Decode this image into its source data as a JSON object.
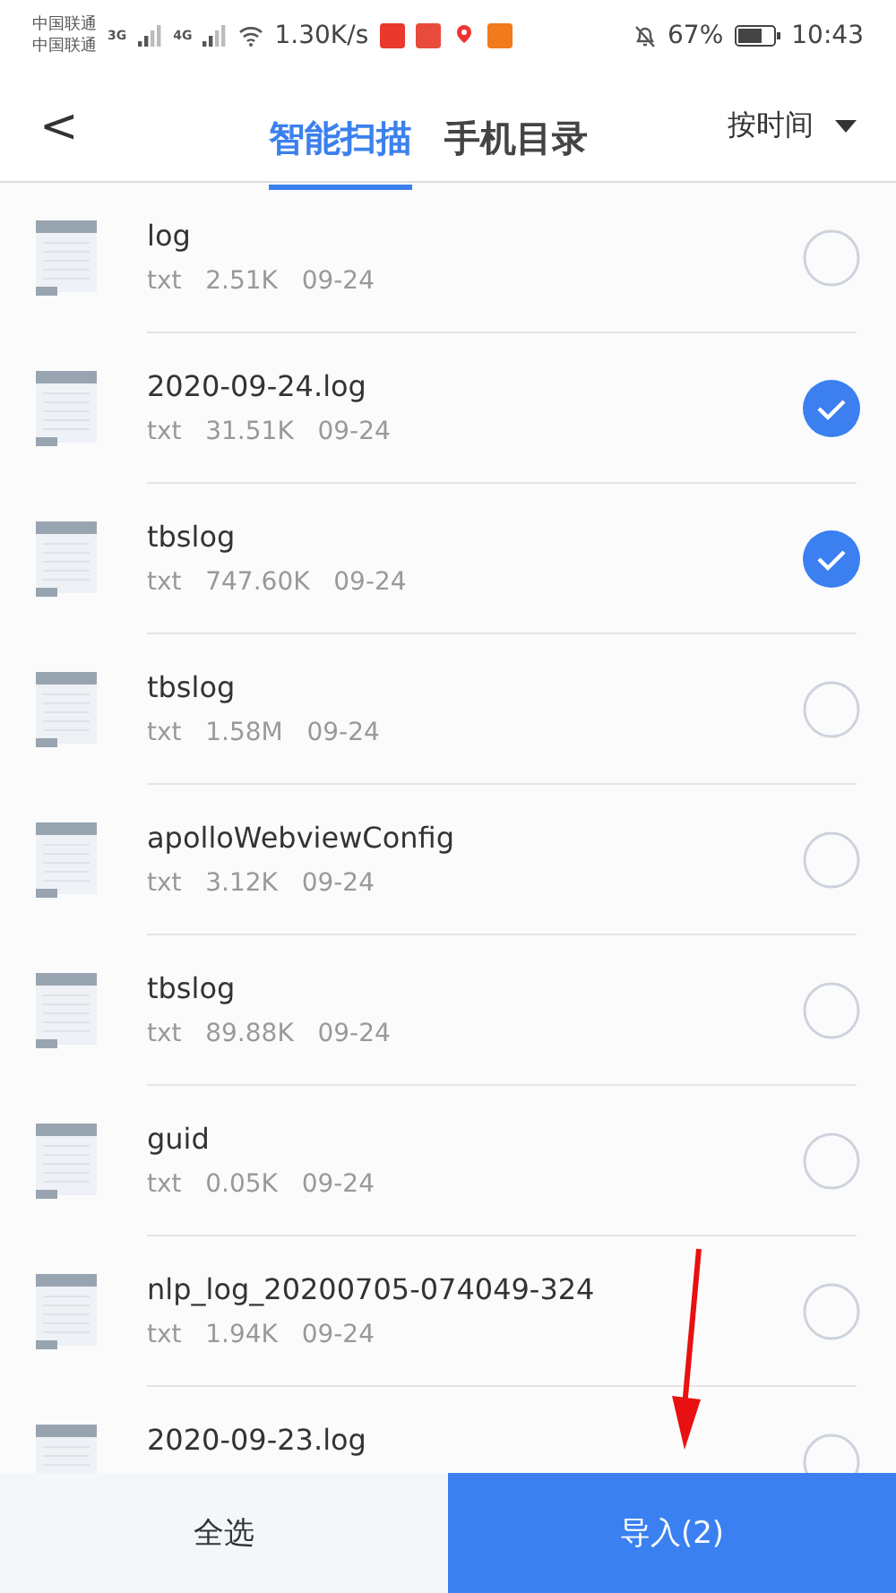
{
  "status_bar": {
    "carriers": [
      "中国联通",
      "中国联通"
    ],
    "networks": [
      "3G",
      "4G"
    ],
    "speed": "1.30K/s",
    "battery": "67%",
    "time": "10:43"
  },
  "header": {
    "back": "<",
    "tabs": [
      {
        "label": "智能扫描",
        "selected": true
      },
      {
        "label": "手机目录",
        "selected": false
      }
    ],
    "sort": "按时间"
  },
  "files": [
    {
      "name": "log",
      "type": "txt",
      "size": "2.51K",
      "date": "09-24",
      "checked": false
    },
    {
      "name": "2020-09-24.log",
      "type": "txt",
      "size": "31.51K",
      "date": "09-24",
      "checked": true
    },
    {
      "name": "tbslog",
      "type": "txt",
      "size": "747.60K",
      "date": "09-24",
      "checked": true
    },
    {
      "name": "tbslog",
      "type": "txt",
      "size": "1.58M",
      "date": "09-24",
      "checked": false
    },
    {
      "name": "apolloWebviewConfig",
      "type": "txt",
      "size": "3.12K",
      "date": "09-24",
      "checked": false
    },
    {
      "name": "tbslog",
      "type": "txt",
      "size": "89.88K",
      "date": "09-24",
      "checked": false
    },
    {
      "name": "guid",
      "type": "txt",
      "size": "0.05K",
      "date": "09-24",
      "checked": false
    },
    {
      "name": "nlp_log_20200705-074049-324",
      "type": "txt",
      "size": "1.94K",
      "date": "09-24",
      "checked": false
    },
    {
      "name": "2020-09-23.log",
      "checked": false
    }
  ],
  "bottom_bar": {
    "select_all": "全选",
    "import": "导入(2)"
  }
}
